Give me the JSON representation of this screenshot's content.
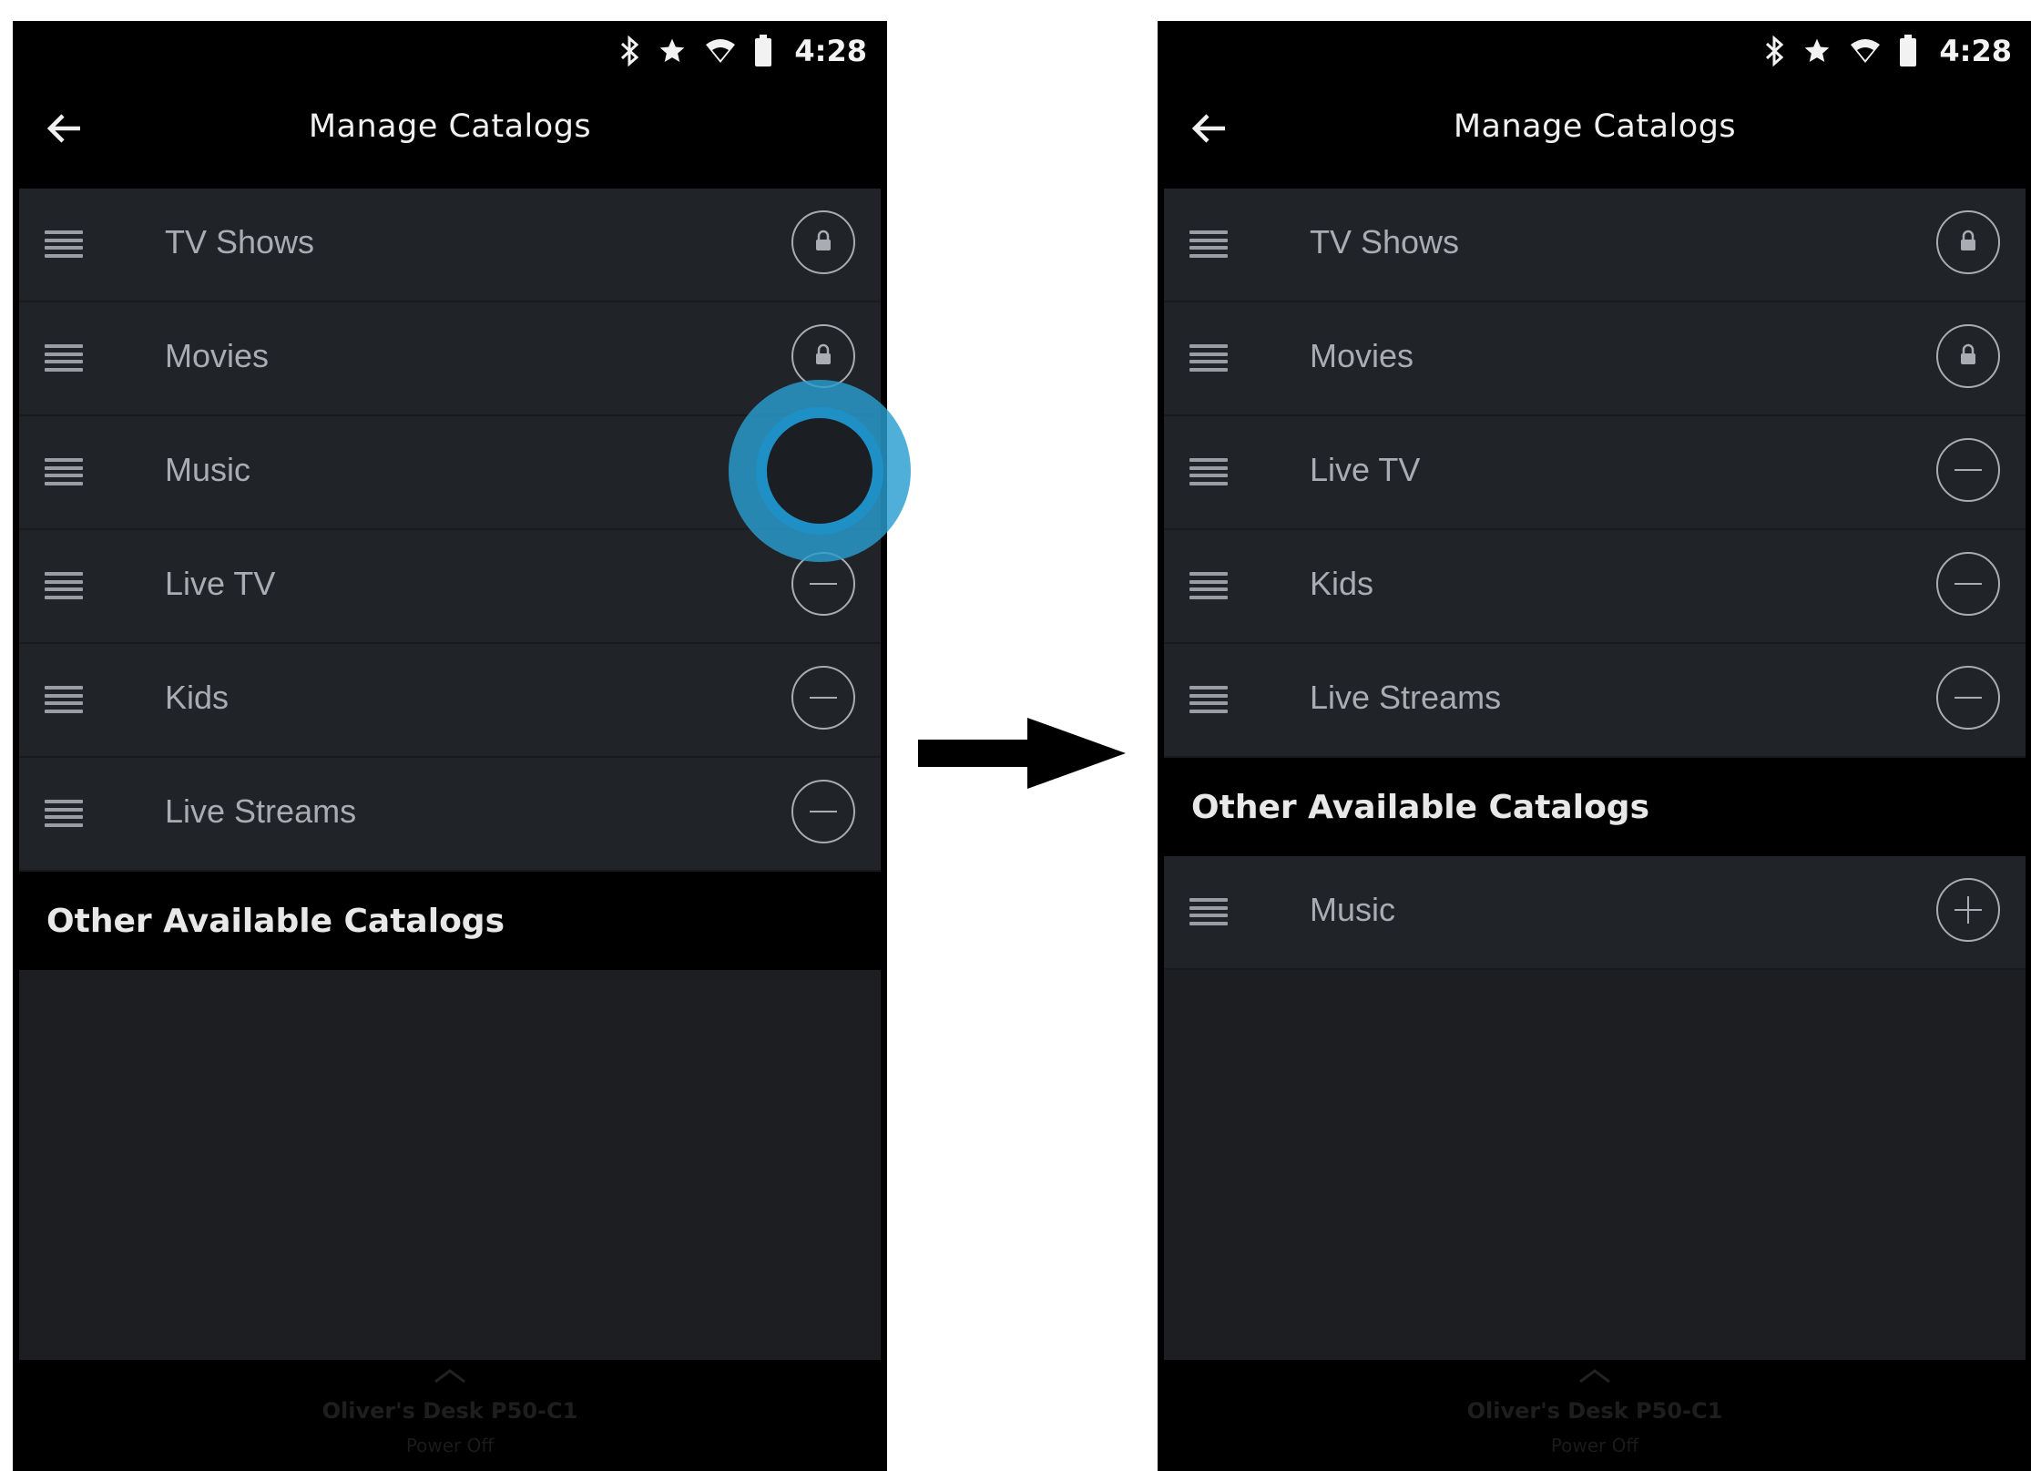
{
  "screens": [
    {
      "status_time": "4:28",
      "title": "Manage Catalogs",
      "active_catalogs": [
        {
          "label": "TV Shows",
          "action": "lock"
        },
        {
          "label": "Movies",
          "action": "lock"
        },
        {
          "label": "Music",
          "action": "remove"
        },
        {
          "label": "Live TV",
          "action": "remove"
        },
        {
          "label": "Kids",
          "action": "remove"
        },
        {
          "label": "Live Streams",
          "action": "remove"
        }
      ],
      "section_title": "Other Available Catalogs",
      "available_catalogs": [],
      "device_name": "Oliver's Desk P50-C1",
      "device_status": "Power Off"
    },
    {
      "status_time": "4:28",
      "title": "Manage Catalogs",
      "active_catalogs": [
        {
          "label": "TV Shows",
          "action": "lock"
        },
        {
          "label": "Movies",
          "action": "lock"
        },
        {
          "label": "Live TV",
          "action": "remove"
        },
        {
          "label": "Kids",
          "action": "remove"
        },
        {
          "label": "Live Streams",
          "action": "remove"
        }
      ],
      "section_title": "Other Available Catalogs",
      "available_catalogs": [
        {
          "label": "Music",
          "action": "add"
        }
      ],
      "device_name": "Oliver's Desk P50-C1",
      "device_status": "Power Off"
    }
  ],
  "icons": {
    "status": [
      "bluetooth-icon",
      "star-icon",
      "wifi-icon",
      "battery-icon"
    ],
    "back": "back-arrow-icon",
    "row_handle": "drag-handle-icon",
    "lock": "lock-icon",
    "remove": "minus-circle-icon",
    "add": "plus-circle-icon",
    "bottom": "chevron-up-icon"
  },
  "colors": {
    "app_background": "#000000",
    "list_background": "#202328",
    "text_primary": "#f0f0f0",
    "text_secondary": "#a9adb3",
    "highlight": "#2a9dcf"
  }
}
